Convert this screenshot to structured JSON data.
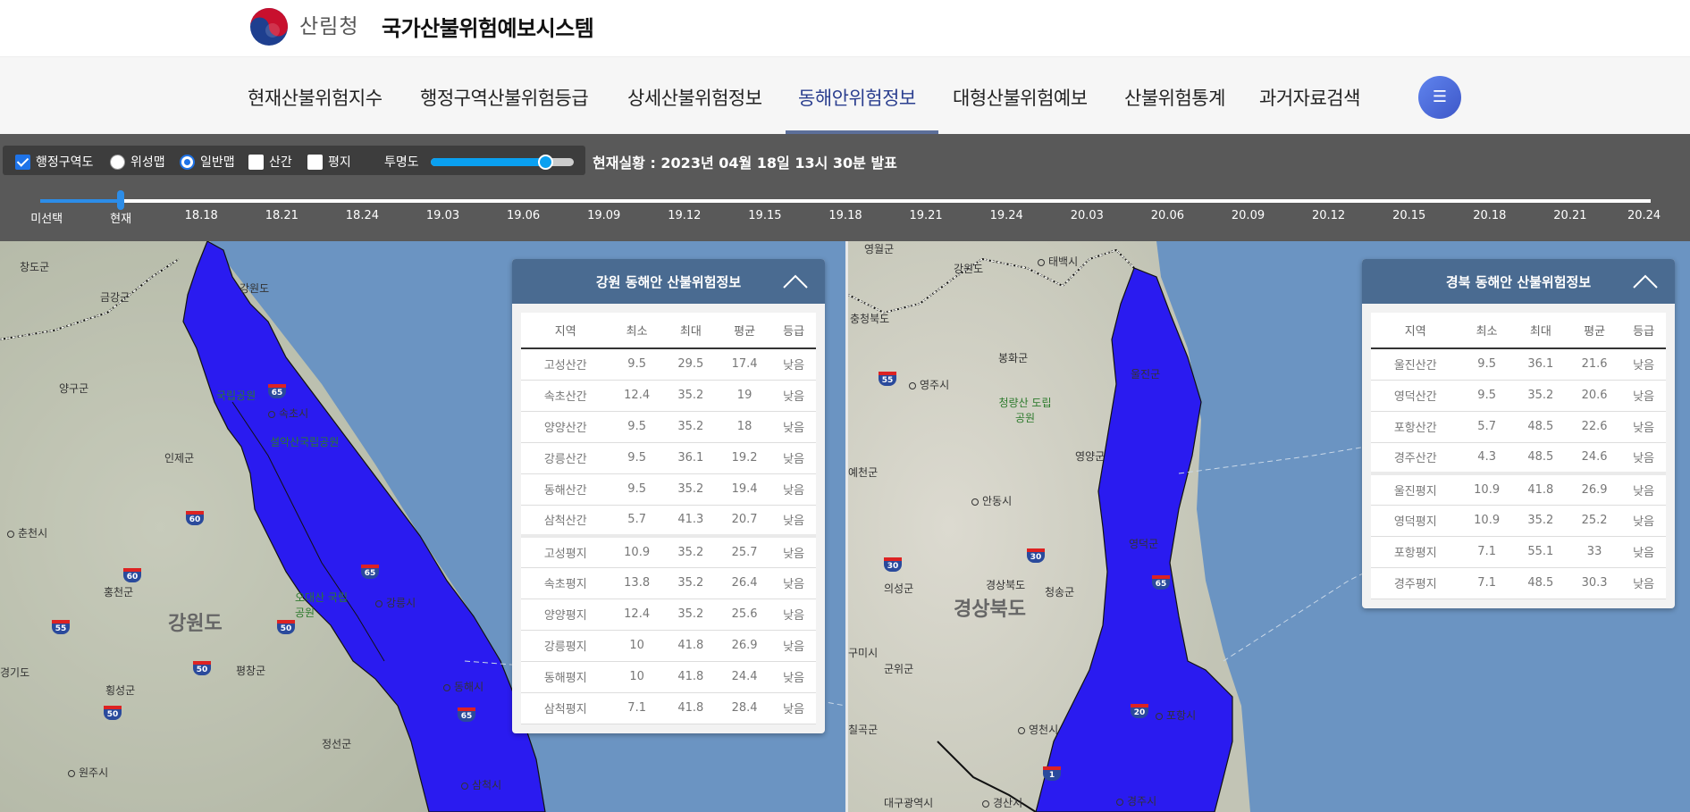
{
  "header": {
    "org_name": "산림청",
    "system_title": "국가산불위험예보시스템"
  },
  "nav": {
    "items": [
      {
        "label": "현재산불위험지수"
      },
      {
        "label": "행정구역산불위험등급"
      },
      {
        "label": "상세산불위험정보"
      },
      {
        "label": "동해안위험정보",
        "active": true
      },
      {
        "label": "대형산불위험예보"
      },
      {
        "label": "산불위험통계"
      },
      {
        "label": "과거자료검색"
      }
    ],
    "menu_icon": "hamburger-icon"
  },
  "controls": {
    "layers": [
      {
        "label": "행정구역도",
        "type": "checkbox",
        "checked": true
      },
      {
        "label": "위성맵",
        "type": "radio",
        "checked": false
      },
      {
        "label": "일반맵",
        "type": "radio",
        "checked": true
      },
      {
        "label": "산간",
        "type": "checkbox",
        "checked": false
      },
      {
        "label": "평지",
        "type": "checkbox",
        "checked": false
      }
    ],
    "opacity_label": "투명도",
    "opacity_value": 0.8,
    "status": "현재실황 : 2023년 04월 18일 13시 30분 발표",
    "timeline": {
      "labels": [
        "미선택",
        "현재",
        "18.18",
        "18.21",
        "18.24",
        "19.03",
        "19.06",
        "19.09",
        "19.12",
        "19.15",
        "19.18",
        "19.21",
        "19.24",
        "20.03",
        "20.06",
        "20.09",
        "20.12",
        "20.15",
        "20.18",
        "20.21",
        "20.24"
      ],
      "selected_index": 1
    }
  },
  "map_left": {
    "places": [
      "창도군",
      "금강군",
      "양구군",
      "인제군",
      "춘천시",
      "홍천군",
      "강원도",
      "평창군",
      "횡성군",
      "원주시",
      "경기도",
      "정선군",
      "속초시",
      "국립공원",
      "설악산국립공원",
      "오대산 국립공원",
      "강릉시",
      "동해시",
      "삼척시",
      "강원도"
    ],
    "routes": [
      "60",
      "60",
      "55",
      "50",
      "50",
      "50",
      "65",
      "65",
      "65"
    ]
  },
  "map_right": {
    "places": [
      "영월군",
      "강원도",
      "태백시",
      "충청북도",
      "봉화군",
      "영주시",
      "청량산 도립공원",
      "영양군",
      "예천군",
      "안동시",
      "의성군",
      "경상북도",
      "청송군",
      "경상북도",
      "군위군",
      "영천시",
      "칠곡군",
      "대구광역시",
      "경산시",
      "구미시",
      "포항시",
      "경주시",
      "울진군",
      "영덕군"
    ],
    "routes": [
      "55",
      "30",
      "30",
      "1",
      "20",
      "65"
    ]
  },
  "panels": {
    "headers": {
      "region": "지역",
      "min": "최소",
      "max": "최대",
      "avg": "평균",
      "grade": "등급"
    },
    "gangwon": {
      "title": "강원 동해안 산불위험정보",
      "rows": [
        {
          "region": "고성산간",
          "min": "9.5",
          "max": "29.5",
          "avg": "17.4",
          "grade": "낮음"
        },
        {
          "region": "속초산간",
          "min": "12.4",
          "max": "35.2",
          "avg": "19",
          "grade": "낮음"
        },
        {
          "region": "양양산간",
          "min": "9.5",
          "max": "35.2",
          "avg": "18",
          "grade": "낮음"
        },
        {
          "region": "강릉산간",
          "min": "9.5",
          "max": "36.1",
          "avg": "19.2",
          "grade": "낮음"
        },
        {
          "region": "동해산간",
          "min": "9.5",
          "max": "35.2",
          "avg": "19.4",
          "grade": "낮음"
        },
        {
          "region": "삼척산간",
          "min": "5.7",
          "max": "41.3",
          "avg": "20.7",
          "grade": "낮음"
        },
        {
          "region": "고성평지",
          "min": "10.9",
          "max": "35.2",
          "avg": "25.7",
          "grade": "낮음"
        },
        {
          "region": "속초평지",
          "min": "13.8",
          "max": "35.2",
          "avg": "26.4",
          "grade": "낮음"
        },
        {
          "region": "양양평지",
          "min": "12.4",
          "max": "35.2",
          "avg": "25.6",
          "grade": "낮음"
        },
        {
          "region": "강릉평지",
          "min": "10",
          "max": "41.8",
          "avg": "26.9",
          "grade": "낮음"
        },
        {
          "region": "동해평지",
          "min": "10",
          "max": "41.8",
          "avg": "24.4",
          "grade": "낮음"
        },
        {
          "region": "삼척평지",
          "min": "7.1",
          "max": "41.8",
          "avg": "28.4",
          "grade": "낮음"
        }
      ]
    },
    "gyeongbuk": {
      "title": "경북 동해안 산불위험정보",
      "rows": [
        {
          "region": "울진산간",
          "min": "9.5",
          "max": "36.1",
          "avg": "21.6",
          "grade": "낮음"
        },
        {
          "region": "영덕산간",
          "min": "9.5",
          "max": "35.2",
          "avg": "20.6",
          "grade": "낮음"
        },
        {
          "region": "포항산간",
          "min": "5.7",
          "max": "48.5",
          "avg": "22.6",
          "grade": "낮음"
        },
        {
          "region": "경주산간",
          "min": "4.3",
          "max": "48.5",
          "avg": "24.6",
          "grade": "낮음"
        },
        {
          "region": "울진평지",
          "min": "10.9",
          "max": "41.8",
          "avg": "26.9",
          "grade": "낮음"
        },
        {
          "region": "영덕평지",
          "min": "10.9",
          "max": "35.2",
          "avg": "25.2",
          "grade": "낮음"
        },
        {
          "region": "포항평지",
          "min": "7.1",
          "max": "55.1",
          "avg": "33",
          "grade": "낮음"
        },
        {
          "region": "경주평지",
          "min": "7.1",
          "max": "48.5",
          "avg": "30.3",
          "grade": "낮음"
        }
      ]
    }
  },
  "colors": {
    "risk_fill": "#2a1bf0",
    "accent": "#2c8de8",
    "panel_header": "#4a6b91"
  }
}
